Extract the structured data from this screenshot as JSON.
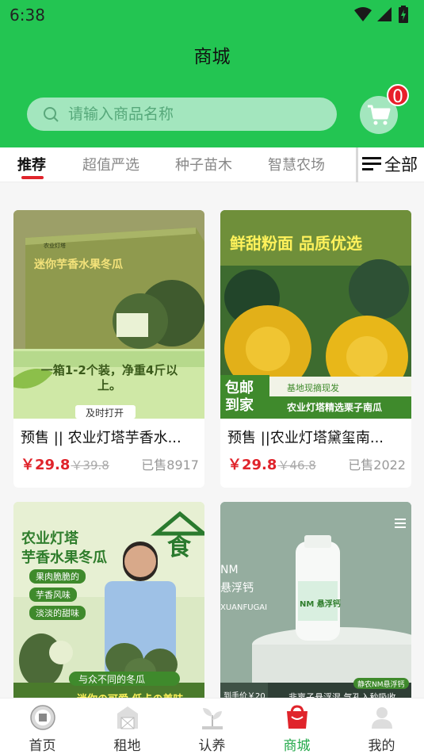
{
  "status_bar": {
    "time": "6:38"
  },
  "header": {
    "title": "商城"
  },
  "search": {
    "placeholder": "请输入商品名称"
  },
  "cart": {
    "badge_count": "0"
  },
  "tabs": [
    {
      "label": "推荐",
      "active": true
    },
    {
      "label": "超值严选",
      "active": false
    },
    {
      "label": "种子苗木",
      "active": false
    },
    {
      "label": "智慧农场",
      "active": false
    }
  ],
  "all_button": {
    "label": "全部"
  },
  "products": [
    {
      "title": "预售 || 农业灯塔芋香水...",
      "price": "￥29.8",
      "old_price": "￥39.8",
      "sold": "已售8917",
      "image_text": {
        "box": "迷你芋香水果冬瓜",
        "brand": "农业灯塔",
        "banner": "一箱1-2个装，净重4斤以上。",
        "tag": "及时打开"
      }
    },
    {
      "title": "预售 ||农业灯塔黛玺南...",
      "price": "￥29.8",
      "old_price": "￥46.8",
      "sold": "已售2022",
      "image_text": {
        "headline": "鲜甜粉面 品质优选",
        "stamp": "包邮到家",
        "small": "基地现摘现发",
        "banner": "农业灯塔精选栗子南瓜"
      }
    },
    {
      "title": "",
      "image_text": {
        "headline1": "农业灯塔",
        "headline2": "芋香水果冬瓜",
        "bullets": [
          "果肉脆脆的",
          "芋香风味",
          "淡淡的甜味"
        ],
        "seal": "食",
        "bottom": "与众不同的冬瓜",
        "bottom2": "迷你の可爱 低卡の美味"
      }
    },
    {
      "title": "",
      "image_text": {
        "brand": "NM",
        "name": "悬浮钙",
        "pinyin": "XUANFUGAI",
        "bottle_label": "NM 悬浮钙",
        "tag": "静农NM悬浮钙",
        "price_tag": "到手价￥20",
        "bottom": "非离子悬浮混 气孔入秒吸收"
      }
    }
  ],
  "bottom_nav": [
    {
      "label": "首页",
      "icon": "home-logo-icon",
      "active": false
    },
    {
      "label": "租地",
      "icon": "farm-building-icon",
      "active": false
    },
    {
      "label": "认养",
      "icon": "sprout-icon",
      "active": false
    },
    {
      "label": "商城",
      "icon": "shopping-bag-icon",
      "active": true
    },
    {
      "label": "我的",
      "icon": "user-icon",
      "active": false
    }
  ],
  "colors": {
    "primary": "#23c552",
    "accent_red": "#e0242b",
    "nav_active": "#23a94a"
  }
}
